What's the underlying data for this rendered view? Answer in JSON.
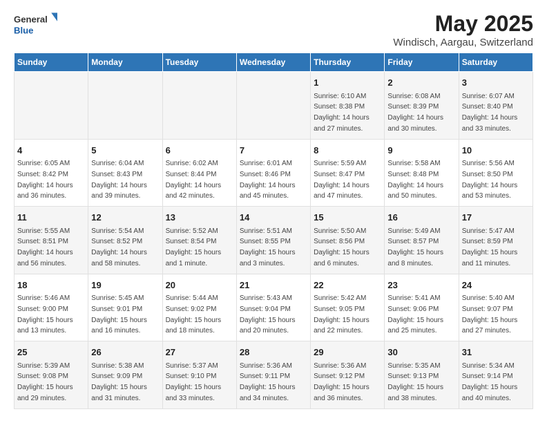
{
  "header": {
    "logo_general": "General",
    "logo_blue": "Blue",
    "title": "May 2025",
    "subtitle": "Windisch, Aargau, Switzerland"
  },
  "weekdays": [
    "Sunday",
    "Monday",
    "Tuesday",
    "Wednesday",
    "Thursday",
    "Friday",
    "Saturday"
  ],
  "weeks": [
    [
      {
        "day": "",
        "info": ""
      },
      {
        "day": "",
        "info": ""
      },
      {
        "day": "",
        "info": ""
      },
      {
        "day": "",
        "info": ""
      },
      {
        "day": "1",
        "info": "Sunrise: 6:10 AM\nSunset: 8:38 PM\nDaylight: 14 hours\nand 27 minutes."
      },
      {
        "day": "2",
        "info": "Sunrise: 6:08 AM\nSunset: 8:39 PM\nDaylight: 14 hours\nand 30 minutes."
      },
      {
        "day": "3",
        "info": "Sunrise: 6:07 AM\nSunset: 8:40 PM\nDaylight: 14 hours\nand 33 minutes."
      }
    ],
    [
      {
        "day": "4",
        "info": "Sunrise: 6:05 AM\nSunset: 8:42 PM\nDaylight: 14 hours\nand 36 minutes."
      },
      {
        "day": "5",
        "info": "Sunrise: 6:04 AM\nSunset: 8:43 PM\nDaylight: 14 hours\nand 39 minutes."
      },
      {
        "day": "6",
        "info": "Sunrise: 6:02 AM\nSunset: 8:44 PM\nDaylight: 14 hours\nand 42 minutes."
      },
      {
        "day": "7",
        "info": "Sunrise: 6:01 AM\nSunset: 8:46 PM\nDaylight: 14 hours\nand 45 minutes."
      },
      {
        "day": "8",
        "info": "Sunrise: 5:59 AM\nSunset: 8:47 PM\nDaylight: 14 hours\nand 47 minutes."
      },
      {
        "day": "9",
        "info": "Sunrise: 5:58 AM\nSunset: 8:48 PM\nDaylight: 14 hours\nand 50 minutes."
      },
      {
        "day": "10",
        "info": "Sunrise: 5:56 AM\nSunset: 8:50 PM\nDaylight: 14 hours\nand 53 minutes."
      }
    ],
    [
      {
        "day": "11",
        "info": "Sunrise: 5:55 AM\nSunset: 8:51 PM\nDaylight: 14 hours\nand 56 minutes."
      },
      {
        "day": "12",
        "info": "Sunrise: 5:54 AM\nSunset: 8:52 PM\nDaylight: 14 hours\nand 58 minutes."
      },
      {
        "day": "13",
        "info": "Sunrise: 5:52 AM\nSunset: 8:54 PM\nDaylight: 15 hours\nand 1 minute."
      },
      {
        "day": "14",
        "info": "Sunrise: 5:51 AM\nSunset: 8:55 PM\nDaylight: 15 hours\nand 3 minutes."
      },
      {
        "day": "15",
        "info": "Sunrise: 5:50 AM\nSunset: 8:56 PM\nDaylight: 15 hours\nand 6 minutes."
      },
      {
        "day": "16",
        "info": "Sunrise: 5:49 AM\nSunset: 8:57 PM\nDaylight: 15 hours\nand 8 minutes."
      },
      {
        "day": "17",
        "info": "Sunrise: 5:47 AM\nSunset: 8:59 PM\nDaylight: 15 hours\nand 11 minutes."
      }
    ],
    [
      {
        "day": "18",
        "info": "Sunrise: 5:46 AM\nSunset: 9:00 PM\nDaylight: 15 hours\nand 13 minutes."
      },
      {
        "day": "19",
        "info": "Sunrise: 5:45 AM\nSunset: 9:01 PM\nDaylight: 15 hours\nand 16 minutes."
      },
      {
        "day": "20",
        "info": "Sunrise: 5:44 AM\nSunset: 9:02 PM\nDaylight: 15 hours\nand 18 minutes."
      },
      {
        "day": "21",
        "info": "Sunrise: 5:43 AM\nSunset: 9:04 PM\nDaylight: 15 hours\nand 20 minutes."
      },
      {
        "day": "22",
        "info": "Sunrise: 5:42 AM\nSunset: 9:05 PM\nDaylight: 15 hours\nand 22 minutes."
      },
      {
        "day": "23",
        "info": "Sunrise: 5:41 AM\nSunset: 9:06 PM\nDaylight: 15 hours\nand 25 minutes."
      },
      {
        "day": "24",
        "info": "Sunrise: 5:40 AM\nSunset: 9:07 PM\nDaylight: 15 hours\nand 27 minutes."
      }
    ],
    [
      {
        "day": "25",
        "info": "Sunrise: 5:39 AM\nSunset: 9:08 PM\nDaylight: 15 hours\nand 29 minutes."
      },
      {
        "day": "26",
        "info": "Sunrise: 5:38 AM\nSunset: 9:09 PM\nDaylight: 15 hours\nand 31 minutes."
      },
      {
        "day": "27",
        "info": "Sunrise: 5:37 AM\nSunset: 9:10 PM\nDaylight: 15 hours\nand 33 minutes."
      },
      {
        "day": "28",
        "info": "Sunrise: 5:36 AM\nSunset: 9:11 PM\nDaylight: 15 hours\nand 34 minutes."
      },
      {
        "day": "29",
        "info": "Sunrise: 5:36 AM\nSunset: 9:12 PM\nDaylight: 15 hours\nand 36 minutes."
      },
      {
        "day": "30",
        "info": "Sunrise: 5:35 AM\nSunset: 9:13 PM\nDaylight: 15 hours\nand 38 minutes."
      },
      {
        "day": "31",
        "info": "Sunrise: 5:34 AM\nSunset: 9:14 PM\nDaylight: 15 hours\nand 40 minutes."
      }
    ]
  ]
}
